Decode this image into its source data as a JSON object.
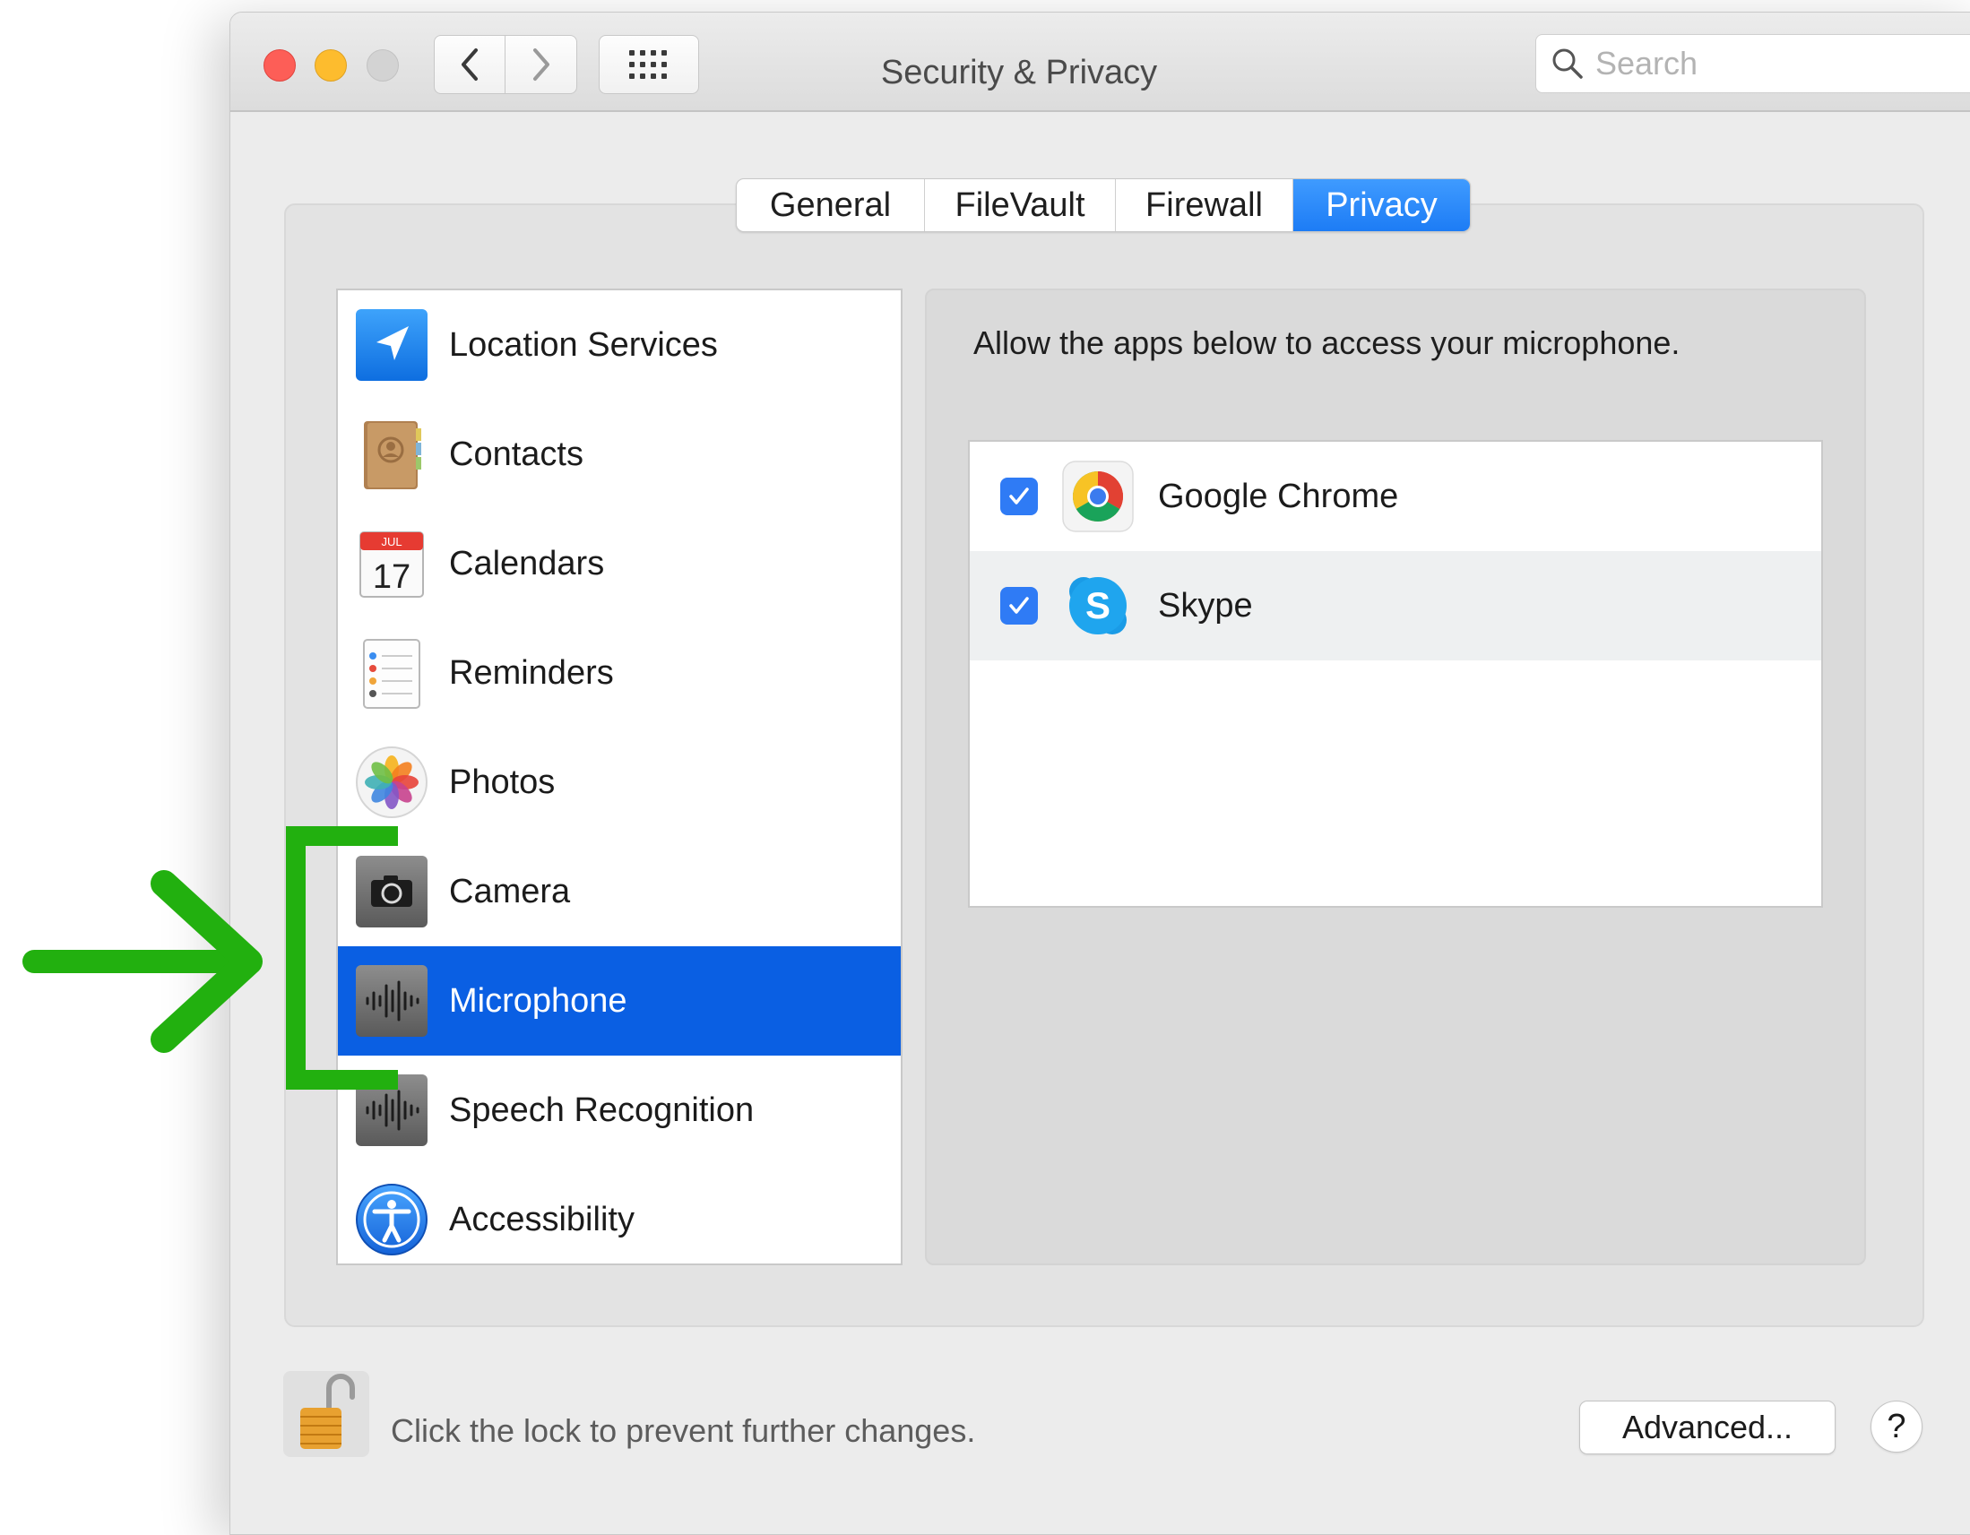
{
  "window": {
    "title": "Security & Privacy",
    "search_placeholder": "Search"
  },
  "tabs": [
    {
      "label": "General",
      "selected": false
    },
    {
      "label": "FileVault",
      "selected": false
    },
    {
      "label": "Firewall",
      "selected": false
    },
    {
      "label": "Privacy",
      "selected": true
    }
  ],
  "categories": [
    {
      "label": "Location Services",
      "icon": "location-arrow-icon",
      "selected": false
    },
    {
      "label": "Contacts",
      "icon": "contacts-book-icon",
      "selected": false
    },
    {
      "label": "Calendars",
      "icon": "calendar-icon",
      "selected": false,
      "icon_month": "JUL",
      "icon_day": "17"
    },
    {
      "label": "Reminders",
      "icon": "reminders-list-icon",
      "selected": false
    },
    {
      "label": "Photos",
      "icon": "photos-flower-icon",
      "selected": false
    },
    {
      "label": "Camera",
      "icon": "camera-icon",
      "selected": false
    },
    {
      "label": "Microphone",
      "icon": "microphone-waveform-icon",
      "selected": true
    },
    {
      "label": "Speech Recognition",
      "icon": "speech-waveform-icon",
      "selected": false
    },
    {
      "label": "Accessibility",
      "icon": "accessibility-person-icon",
      "selected": false
    }
  ],
  "privacy_pane": {
    "instruction": "Allow the apps below to access your microphone.",
    "apps": [
      {
        "name": "Google Chrome",
        "icon": "chrome-icon",
        "checked": true
      },
      {
        "name": "Skype",
        "icon": "skype-icon",
        "checked": true
      }
    ]
  },
  "footer": {
    "lock_text": "Click the lock to prevent further changes.",
    "advanced_label": "Advanced...",
    "help_label": "?"
  },
  "colors": {
    "accent": "#0a5fe3",
    "tab_selected": "#1d7cf5",
    "annotation_green": "#22b00f",
    "checkbox": "#2f7bf5"
  }
}
